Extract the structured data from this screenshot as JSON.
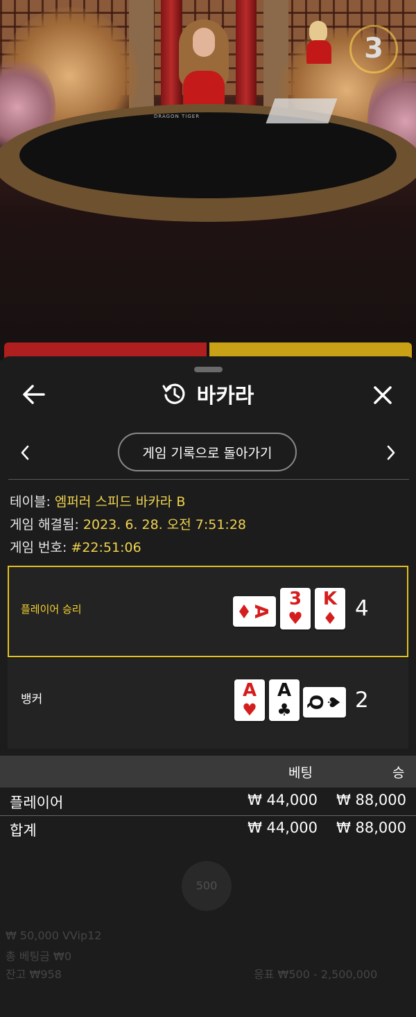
{
  "scene": {
    "countdown": "3",
    "table_brand": "DRAGON        TIGER"
  },
  "sheet": {
    "title": "바카라",
    "return_button": "게임 기록으로 돌아가기",
    "info": {
      "table_label": "테이블:",
      "table_value": "엠퍼러 스피드 바카라 B",
      "resolved_label": "게임 해결됨:",
      "resolved_value": "2023. 6. 28. 오전 7:51:28",
      "number_label": "게임 번호:",
      "number_value": "#22:51:06"
    },
    "player": {
      "label": "플레이어 승리",
      "score": "4",
      "cards": [
        {
          "rank": "A",
          "suit": "♦",
          "color": "red",
          "orientation": "horizontal"
        },
        {
          "rank": "3",
          "suit": "♥",
          "color": "red",
          "orientation": "vertical"
        },
        {
          "rank": "K",
          "suit": "♦",
          "color": "red",
          "orientation": "vertical"
        }
      ]
    },
    "banker": {
      "label": "뱅커",
      "score": "2",
      "cards": [
        {
          "rank": "A",
          "suit": "♥",
          "color": "red",
          "orientation": "vertical"
        },
        {
          "rank": "A",
          "suit": "♣",
          "color": "black",
          "orientation": "vertical"
        },
        {
          "rank": "Q",
          "suit": "♠",
          "color": "black",
          "orientation": "horizontal"
        }
      ]
    },
    "results": {
      "header_bet": "베팅",
      "header_win": "승",
      "rows": [
        {
          "name": "플레이어",
          "bet": "₩ 44,000",
          "win": "₩ 88,000"
        },
        {
          "name": "합계",
          "bet": "₩ 44,000",
          "win": "₩ 88,000"
        }
      ]
    }
  },
  "background_ui": {
    "balance_lines": [
      "₩ 50,000 VVip12",
      "총 베팅금 ₩0",
      "잔고 ₩958"
    ],
    "limits": "응표 ₩500 - 2,500,000",
    "chip": "500"
  },
  "colors": {
    "player_red": "#b01f1f",
    "banker_gold": "#c9a116",
    "highlight": "#e3c21f",
    "value_yellow": "#f1d44e"
  }
}
